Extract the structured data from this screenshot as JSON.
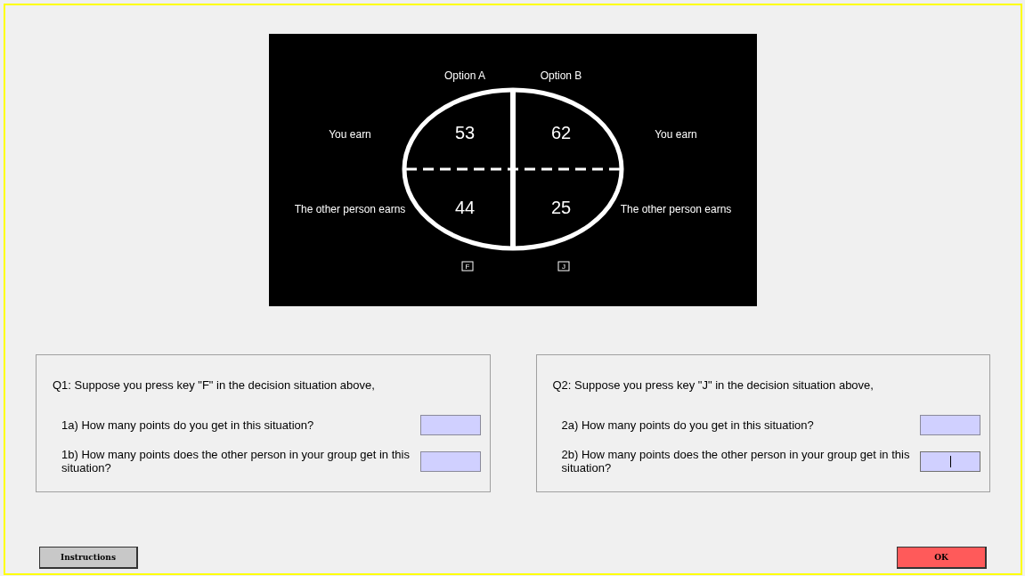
{
  "stimulus": {
    "options": [
      {
        "label": "Option A",
        "you_earn": "53",
        "other_earns": "44",
        "key": "F"
      },
      {
        "label": "Option B",
        "you_earn": "62",
        "other_earns": "25",
        "key": "J"
      }
    ],
    "left_labels": {
      "you": "You earn",
      "other": "The other person earns"
    },
    "right_labels": {
      "you": "You earn",
      "other": "The other person earns"
    }
  },
  "questions": [
    {
      "title": "Q1: Suppose you press key \"F\" in the decision situation above,",
      "items": [
        {
          "text": "1a) How many points do you get in this situation?",
          "focused": false
        },
        {
          "text": "1b) How many points does the other person in your group get in this situation?",
          "focused": false
        }
      ]
    },
    {
      "title": "Q2: Suppose you press key \"J\" in the decision situation above,",
      "items": [
        {
          "text": "2a) How many points do you get in this situation?",
          "focused": false
        },
        {
          "text": "2b) How many points does the other person in your group get in this situation?",
          "focused": true
        }
      ]
    }
  ],
  "buttons": [
    {
      "label": "Instructions",
      "kind": "secondary"
    },
    {
      "label": "OK",
      "kind": "primary"
    }
  ]
}
